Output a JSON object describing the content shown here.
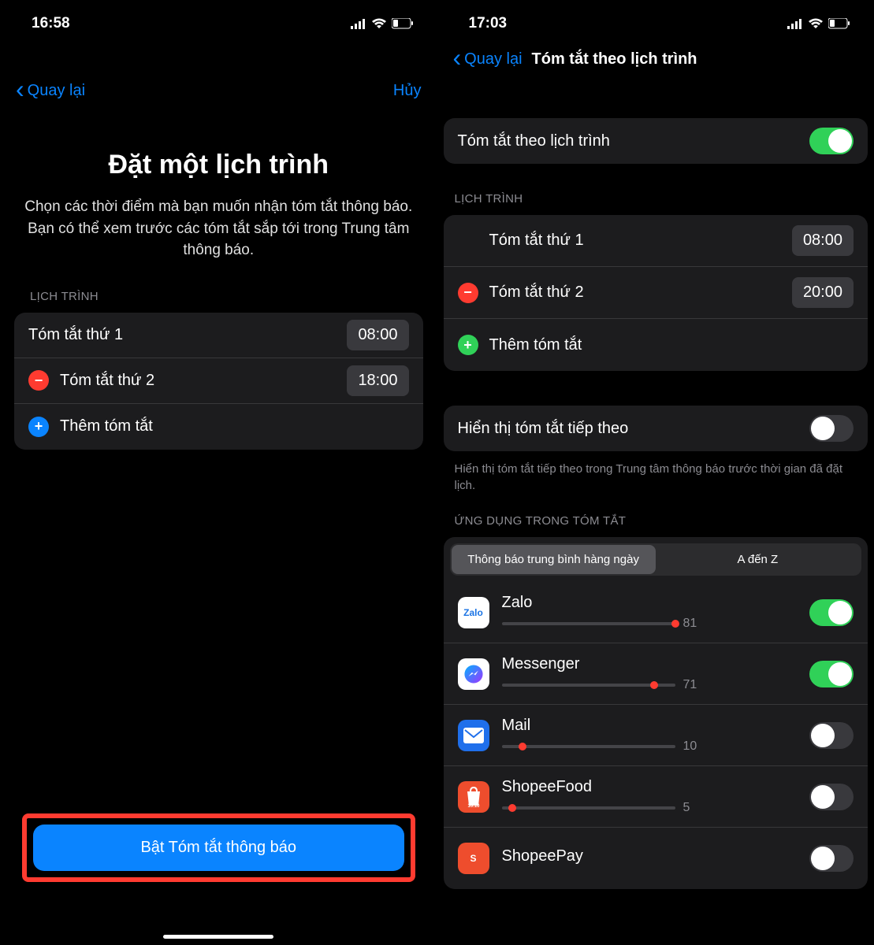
{
  "left": {
    "status_time": "16:58",
    "nav_back": "Quay lại",
    "nav_cancel": "Hủy",
    "title": "Đặt một lịch trình",
    "desc": "Chọn các thời điểm mà bạn muốn nhận tóm tắt thông báo. Bạn có thể xem trước các tóm tắt sắp tới trong Trung tâm thông báo.",
    "schedule_header": "LỊCH TRÌNH",
    "sum1": {
      "label": "Tóm tắt thứ 1",
      "time": "08:00"
    },
    "sum2": {
      "label": "Tóm tắt thứ 2",
      "time": "18:00"
    },
    "add": "Thêm tóm tắt",
    "cta": "Bật Tóm tắt thông báo"
  },
  "right": {
    "status_time": "17:03",
    "nav_back": "Quay lại",
    "nav_title": "Tóm tắt theo lịch trình",
    "main_toggle_label": "Tóm tắt theo lịch trình",
    "schedule_header": "LỊCH TRÌNH",
    "sum1": {
      "label": "Tóm tắt thứ 1",
      "time": "08:00"
    },
    "sum2": {
      "label": "Tóm tắt thứ 2",
      "time": "20:00"
    },
    "add": "Thêm tóm tắt",
    "next_toggle_label": "Hiển thị tóm tắt tiếp theo",
    "next_footnote": "Hiển thị tóm tắt tiếp theo trong Trung tâm thông báo trước thời gian đã đặt lịch.",
    "apps_header": "ỨNG DỤNG TRONG TÓM TẮT",
    "seg_avg": "Thông báo trung bình hàng ngày",
    "seg_az": "A đến Z",
    "apps": [
      {
        "name": "Zalo",
        "count": "81",
        "pct": 100,
        "icon_bg": "#ffffff",
        "icon_fg": "#1b74e4",
        "icon_text": "Zalo",
        "on": true
      },
      {
        "name": "Messenger",
        "count": "71",
        "pct": 88,
        "icon_bg": "#ffffff",
        "icon_fg": "#a033ff",
        "icon_text": "",
        "on": true
      },
      {
        "name": "Mail",
        "count": "10",
        "pct": 12,
        "icon_bg": "#1f6feb",
        "icon_fg": "#ffffff",
        "icon_text": "",
        "on": false
      },
      {
        "name": "ShopeeFood",
        "count": "5",
        "pct": 6,
        "icon_bg": "#ee4d2d",
        "icon_fg": "#ffffff",
        "icon_text": "",
        "on": false
      },
      {
        "name": "ShopeePay",
        "count": "",
        "pct": 0,
        "icon_bg": "#ee4d2d",
        "icon_fg": "#ffffff",
        "icon_text": "S",
        "on": false
      }
    ]
  }
}
